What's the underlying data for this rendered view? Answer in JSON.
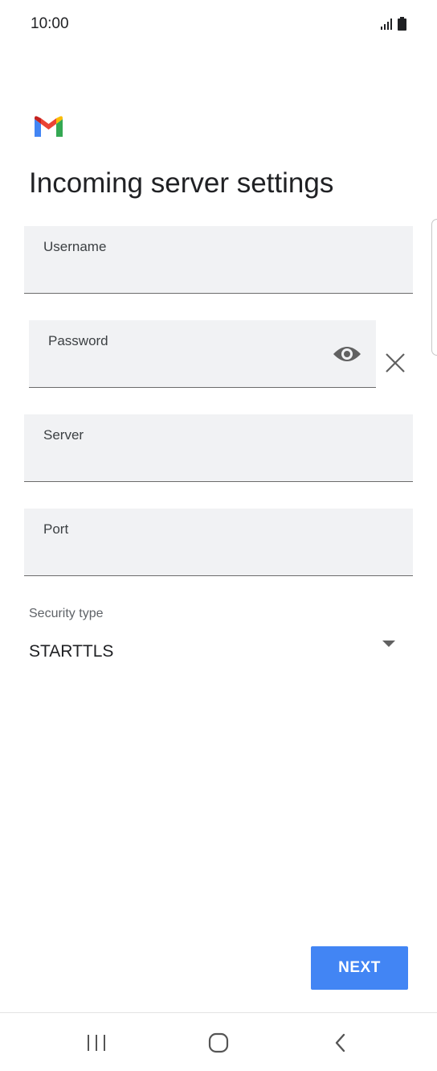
{
  "status_bar": {
    "time": "10:00",
    "icons": [
      "signal-icon",
      "battery-icon"
    ]
  },
  "header": {
    "logo": "gmail-logo",
    "title": "Incoming server settings"
  },
  "form": {
    "username": {
      "label": "Username",
      "value": ""
    },
    "password": {
      "label": "Password",
      "value": "",
      "icons": [
        "eye-icon",
        "close-icon"
      ]
    },
    "server": {
      "label": "Server",
      "value": ""
    },
    "port": {
      "label": "Port",
      "value": ""
    },
    "security": {
      "label": "Security type",
      "value": "STARTTLS",
      "icon": "dropdown-arrow-icon"
    }
  },
  "actions": {
    "next_label": "NEXT"
  },
  "nav_bar": {
    "icons": [
      "recent-apps-icon",
      "home-icon",
      "back-icon"
    ]
  },
  "colors": {
    "accent": "#4285f4",
    "field_bg": "#f1f2f4",
    "text": "#202124",
    "gmail_red": "#EA4335",
    "gmail_blue": "#4285F4",
    "gmail_green": "#34A853",
    "gmail_yellow": "#FBBC04"
  }
}
